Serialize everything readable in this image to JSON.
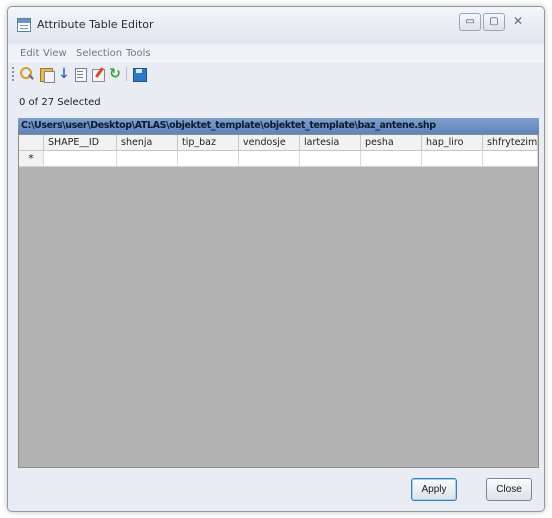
{
  "window": {
    "title": "Attribute Table Editor",
    "controls": {
      "minimize": "▭",
      "maximize": "▢",
      "close": "✕"
    }
  },
  "menu": [
    "Edit",
    "View",
    "Selection",
    "Tools"
  ],
  "toolbar": {
    "icons": [
      "search-icon",
      "table-icon",
      "down-arrow-icon",
      "document-icon",
      "edit-icon",
      "refresh-icon",
      "save-icon"
    ],
    "down_glyph": "↓",
    "refresh_glyph": "↻"
  },
  "status": {
    "selection_count": "0 of 27 Selected"
  },
  "table": {
    "path": "C:\\Users\\user\\Desktop\\ATLAS\\objektet_template\\objektet_template\\baz_antene.shp",
    "columns": [
      "SHAPE__ID",
      "shenja",
      "tip_baz",
      "vendosje",
      "lartesia",
      "pesha",
      "hap_liro",
      "shfrytezim"
    ],
    "new_row_marker": "*"
  },
  "buttons": {
    "apply": "Apply",
    "close": "Close"
  },
  "colors": {
    "path_bar": "#6f92c4",
    "grid_background": "#b3b3b3",
    "window": "#e9edf3"
  }
}
